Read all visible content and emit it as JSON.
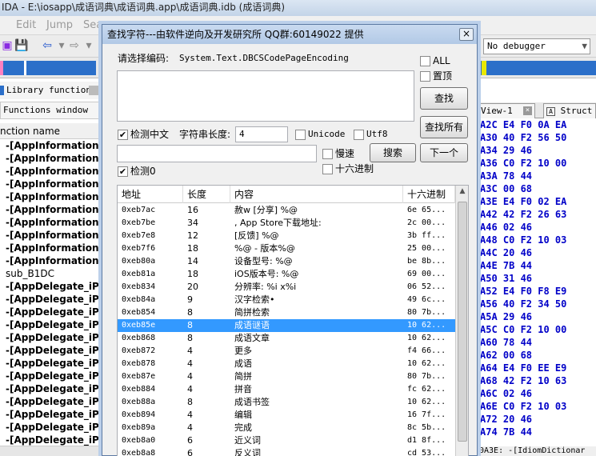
{
  "ida": {
    "title": "IDA - E:\\iosapp\\成语词典\\成语词典.app\\成语词典.idb (成语词典)",
    "menu": [
      "Edit",
      "Jump",
      "Sea"
    ],
    "legend": "Library function",
    "functions_window_tab": "Functions window",
    "function_name_header": "nction name",
    "functions": [
      "-[AppInformationS",
      "-[AppInformationS",
      "-[AppInformationS",
      "-[AppInformationS",
      "-[AppInformationS",
      "-[AppInformationS",
      "-[AppInformationS",
      "-[AppInformationS",
      "-[AppInformationS",
      "-[AppInformationS",
      "sub_B1DC",
      "-[AppDelegate_iPh",
      "-[AppDelegate_iPh",
      "-[AppDelegate_iPh",
      "-[AppDelegate_iPh",
      "-[AppDelegate_iPh",
      "-[AppDelegate_iPh",
      "-[AppDelegate_iPh",
      "-[AppDelegate_iPh",
      "-[AppDelegate_iPh",
      "-[AppDelegate_iPh",
      "-[AppDelegate_iPh",
      "-[AppDelegate_iPh",
      "-[AppDelegate_iPh",
      "-[AppDelegate_iPh"
    ],
    "debugger": "No debugger",
    "tabs": {
      "view": "View-1",
      "struct": "Struct"
    },
    "hex_rows": [
      "A2C E4 F0 0A EA",
      "A30 40 F2 56 50",
      "A34 29 46",
      "A36 C0 F2 10 00",
      "A3A 78 44",
      "A3C 00 68",
      "A3E E4 F0 02 EA",
      "A42 42 F2 26 63",
      "A46 02 46",
      "A48 C0 F2 10 03",
      "A4C 20 46",
      "A4E 7B 44",
      "A50 31 46",
      "A52 E4 F0 F8 E9",
      "A56 40 F2 34 50",
      "A5A 29 46",
      "A5C C0 F2 10 00",
      "A60 78 44",
      "A62 00 68",
      "A64 E4 F0 EE E9",
      "A68 42 F2 10 63",
      "A6C 02 46",
      "A6E C0 F2 10 03",
      "A72 20 46",
      "A74 7B 44"
    ],
    "hex_bottom": "0A3E: -[IdiomDictionar"
  },
  "dialog": {
    "title": "查找字符---由软件逆向及开发研究所 QQ群:60149022 提供",
    "close": "×",
    "encoding_label": "请选择编码:",
    "encoding_value": "System.Text.DBCSCodePageEncoding",
    "all_label": "ALL",
    "top_label": "置顶",
    "find_button": "查找",
    "find_all_button": "查找所有",
    "detect_cn_label": "检测中文",
    "strlen_label": "字符串长度:",
    "strlen_value": "4",
    "unicode_label": "Unicode",
    "utf8_label": "Utf8",
    "slow_label": "慢速",
    "search_button": "搜索",
    "next_button": "下一个",
    "detect0_label": "检测0",
    "hex_label": "十六进制",
    "checks": {
      "all": "",
      "top": "",
      "detect_cn": "✔",
      "unicode": "",
      "utf8": "",
      "slow": "",
      "detect0": "✔",
      "hex": ""
    },
    "columns": [
      "地址",
      "长度",
      "内容",
      "十六进制"
    ],
    "rows": [
      [
        "0xeb7ac",
        "16",
        "赦w [分享] %@",
        "6e 65..."
      ],
      [
        "0xeb7be",
        "34",
        ", App Store下载地址:",
        "2c 00..."
      ],
      [
        "0xeb7e8",
        "12",
        "[反馈] %@",
        "3b ff..."
      ],
      [
        "0xeb7f6",
        "18",
        "%@ - 版本%@",
        "25 00..."
      ],
      [
        "0xeb80a",
        "14",
        "设备型号: %@",
        "be 8b..."
      ],
      [
        "0xeb81a",
        "18",
        "iOS版本号: %@",
        "69 00..."
      ],
      [
        "0xeb834",
        "20",
        "分辨率: %i x%i",
        "06 52..."
      ],
      [
        "0xeb84a",
        "9",
        "汉字检索•",
        "49 6c..."
      ],
      [
        "0xeb854",
        "8",
        "简拼检索",
        "80 7b..."
      ],
      [
        "0xeb85e",
        "8",
        "成语谜语",
        "10 62..."
      ],
      [
        "0xeb868",
        "8",
        "成语文章",
        "10 62..."
      ],
      [
        "0xeb872",
        "4",
        "更多",
        "f4 66..."
      ],
      [
        "0xeb878",
        "4",
        "成语",
        "10 62..."
      ],
      [
        "0xeb87e",
        "4",
        "简拼",
        "80 7b..."
      ],
      [
        "0xeb884",
        "4",
        "拼音",
        "fc 62..."
      ],
      [
        "0xeb88a",
        "8",
        "成语书签",
        "10 62..."
      ],
      [
        "0xeb894",
        "4",
        "编辑",
        "16 7f..."
      ],
      [
        "0xeb89a",
        "4",
        "完成",
        "8c 5b..."
      ],
      [
        "0xeb8a0",
        "6",
        "近义词",
        "d1 8f..."
      ],
      [
        "0xeb8a8",
        "6",
        "反义词",
        "cd 53..."
      ]
    ],
    "selected_row": 9
  }
}
